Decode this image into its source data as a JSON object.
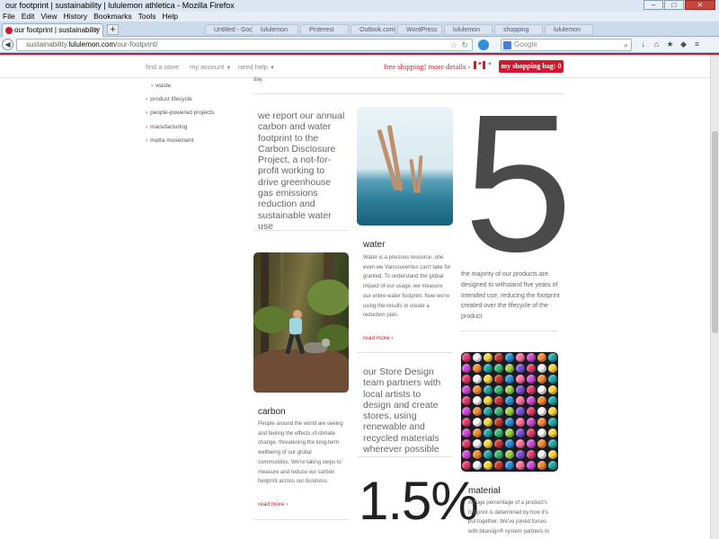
{
  "browser": {
    "window_title": "our footprint | sustainability | lululemon athletica - Mozilla Firefox",
    "menu": [
      "File",
      "Edit",
      "View",
      "History",
      "Bookmarks",
      "Tools",
      "Help"
    ],
    "active_tab": "our footprint | sustainability | lululemon...",
    "background_tabs": [
      "Untitled - Google",
      "lululemon",
      "Pinterest",
      "Outlook.com",
      "WordPress",
      "lululemon",
      "shopping",
      "lululemon"
    ],
    "url_prefix": "sustainability.",
    "url_host": "lululemon.com",
    "url_path": "/our-footprint/",
    "search_placeholder": "Google"
  },
  "header": {
    "links": [
      "find a store",
      "my account",
      "need help"
    ],
    "free_shipping": "free shipping! more details ›",
    "bag_label": "my shopping bag: 0"
  },
  "sidebar": {
    "items": [
      "waste",
      "product lifecycle",
      "people-powered projects",
      "manufacturing",
      "metta movement"
    ]
  },
  "content": {
    "top_fragment": "day.",
    "quote_carbon_disclosure": "we report our annual carbon and water footprint to the Carbon Disclosure Project, a not-for-profit working to drive greenhouse gas emissions reduction and sustainable water use",
    "water": {
      "title": "water",
      "body": "Water is a precious resource, one even we Vancouverites can't take for granted. To understand the global impact of our usage, we measure our entire water footprint. Now we're using the results to create a reduction plan.",
      "read_more": "read more ›"
    },
    "stat_five": {
      "number": "5",
      "caption": "the majority of our products are designed to withstand five years of intended use, reducing the footprint created over the lifecycle of the product"
    },
    "carbon": {
      "title": "carbon",
      "body": "People around the world are seeing and feeling the effects of climate change, threatening the long-term wellbeing of our global communities. We're taking steps to measure and reduce our carbon footprint across our business.",
      "read_more": "read more ›"
    },
    "quote_store_design": "our Store Design team partners with local artists to design and create stores, using renewable and recycled materials wherever possible",
    "stat_percent": {
      "number": "1.5%"
    },
    "material": {
      "title": "material",
      "body": "A huge percentage of a product's footprint is determined by how it's put together. We've joined forces with bluesign® system partners to"
    }
  },
  "colors": {
    "brand_red": "#d2192b",
    "text_gray": "#666666",
    "stat_gray": "#4a4a4a"
  }
}
